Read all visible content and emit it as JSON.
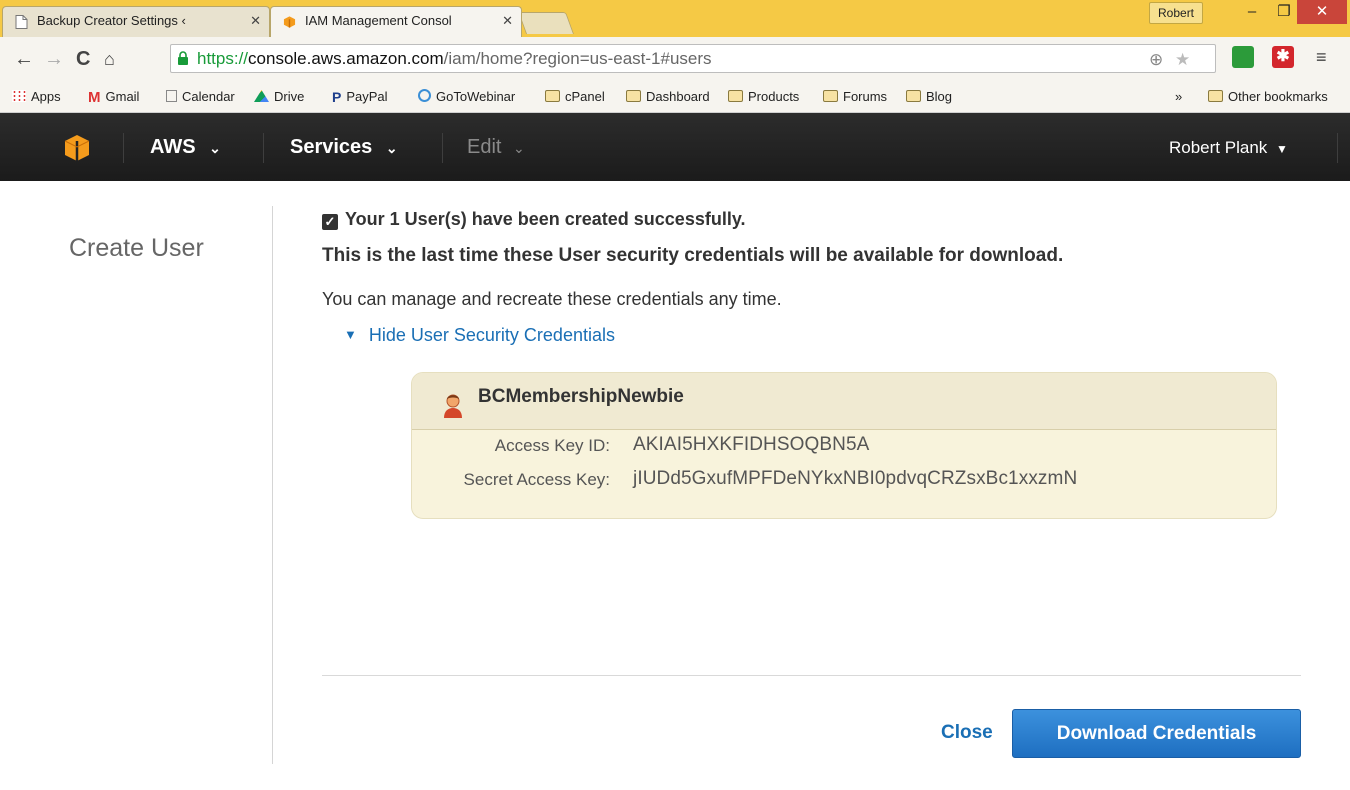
{
  "browser": {
    "tabs": [
      {
        "title": "Backup Creator Settings ‹",
        "active": false
      },
      {
        "title": "IAM Management Consol",
        "active": true
      }
    ],
    "profile_name": "Robert",
    "url": {
      "scheme": "https://",
      "host": "console.aws.amazon.com",
      "path": "/iam/home?region=us-east-1#users"
    },
    "bookmarks": [
      "Apps",
      "Gmail",
      "Calendar",
      "Drive",
      "PayPal",
      "GoToWebinar",
      "cPanel",
      "Dashboard",
      "Products",
      "Forums",
      "Blog"
    ],
    "bookmarks_overflow": "»",
    "other_bookmarks": "Other bookmarks"
  },
  "aws_nav": {
    "aws_label": "AWS",
    "services_label": "Services",
    "edit_label": "Edit",
    "user_label": "Robert Plank"
  },
  "page": {
    "left_title": "Create User",
    "success_message": "Your 1 User(s) have been created successfully.",
    "warning_message": "This is the last time these User security credentials will be available for download.",
    "manage_message": "You can manage and recreate these credentials any time.",
    "toggle_label": "Hide User Security Credentials",
    "credentials": {
      "username": "BCMembershipNewbie",
      "access_key_label": "Access Key ID:",
      "access_key_value": "AKIAI5HXKFIDHSOQBN5A",
      "secret_key_label": "Secret Access Key:",
      "secret_key_value": "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"
    },
    "close_label": "Close",
    "download_label": "Download Credentials"
  },
  "colors": {
    "link_blue": "#1a6fb5",
    "button_blue": "#2a7fcf",
    "nav_dark": "#232323",
    "credential_box": "#f8f3dc",
    "aws_orange": "#f49b1c"
  }
}
